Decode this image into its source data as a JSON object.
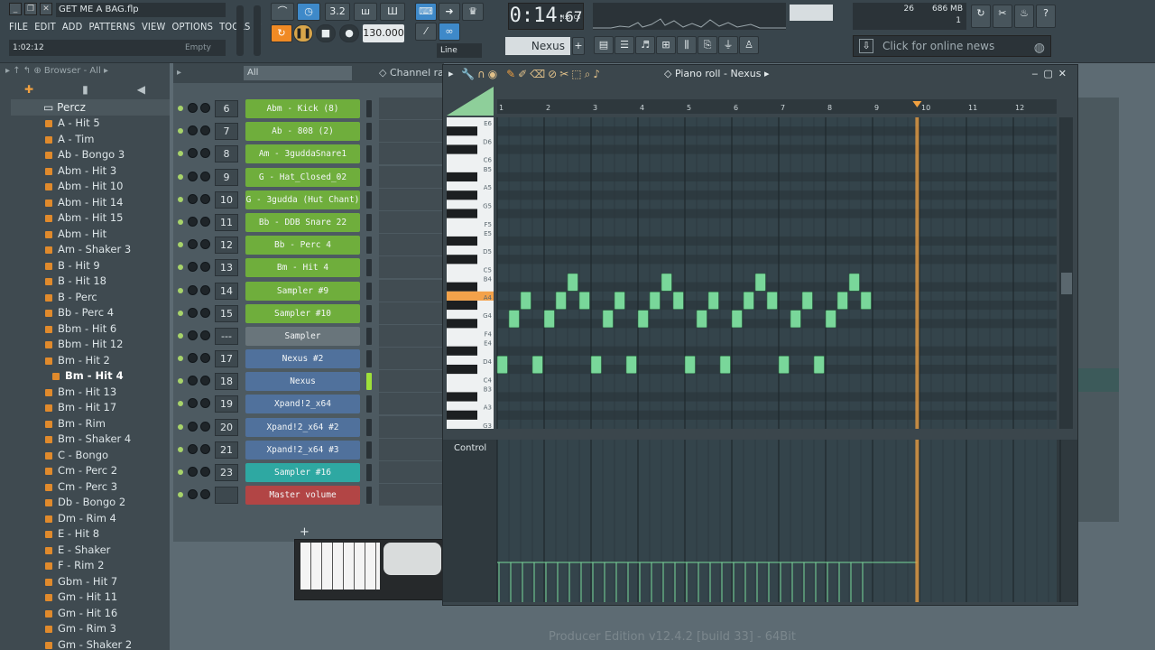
{
  "window": {
    "project_title": "GET ME A BAG.flp",
    "hint_time": "1:02:12",
    "hint_value": "Empty",
    "footer": "Producer Edition v12.4.2 [build 33] - 64Bit"
  },
  "menu": [
    "FILE",
    "EDIT",
    "ADD",
    "PATTERNS",
    "VIEW",
    "OPTIONS",
    "TOOLS",
    "?"
  ],
  "transport": {
    "time_main": "0:14",
    "time_sub": "67",
    "time_unit": "M:S:CS",
    "tempo": "130.000",
    "pattern_step": "3.2",
    "snap": "Line",
    "instrument": "Nexus"
  },
  "cpu": {
    "value": "26",
    "memory": "686 MB",
    "poly": "1"
  },
  "news": {
    "text": "Click for online news"
  },
  "browser": {
    "header": "Browser - All",
    "folder": "Percz",
    "active_item": "Bm - Hit 4",
    "items": [
      "A - Hit 5",
      "A - Tim",
      "Ab - Bongo 3",
      "Abm - Hit 3",
      "Abm - Hit 10",
      "Abm - Hit 14",
      "Abm - Hit 15",
      "Abm - Hit",
      "Am - Shaker 3",
      "B - Hit 9",
      "B - Hit 18",
      "B - Perc",
      "Bb - Perc 4",
      "Bbm - Hit 6",
      "Bbm - Hit 12",
      "Bm - Hit 2",
      "Bm - Hit 4",
      "Bm - Hit 13",
      "Bm - Hit 17",
      "Bm - Rim",
      "Bm - Shaker 4",
      "C - Bongo",
      "Cm - Perc 2",
      "Cm - Perc 3",
      "Db - Bongo 2",
      "Dm - Rim 4",
      "E - Hit 8",
      "E - Shaker",
      "F - Rim 2",
      "Gbm - Hit 7",
      "Gm - Hit 11",
      "Gm - Hit 16",
      "Gm - Rim 3",
      "Gm - Shaker 2"
    ]
  },
  "rack": {
    "filter": "All",
    "title": "Channel ra",
    "channels": [
      {
        "num": "6",
        "name": "Abm - Kick (8)",
        "color": "green",
        "meter": false
      },
      {
        "num": "7",
        "name": "Ab - 808 (2)",
        "color": "green",
        "meter": false
      },
      {
        "num": "8",
        "name": "Am - 3guddaSnare1",
        "color": "green",
        "meter": false
      },
      {
        "num": "9",
        "name": "G - Hat_Closed_02",
        "color": "green",
        "meter": false
      },
      {
        "num": "10",
        "name": "G - 3gudda (Hut Chant)",
        "color": "green",
        "meter": false
      },
      {
        "num": "11",
        "name": "Bb - DDB Snare 22",
        "color": "green",
        "meter": false
      },
      {
        "num": "12",
        "name": "Bb - Perc 4",
        "color": "green",
        "meter": false
      },
      {
        "num": "13",
        "name": "Bm - Hit 4",
        "color": "green",
        "meter": false
      },
      {
        "num": "14",
        "name": "Sampler #9",
        "color": "green",
        "meter": false
      },
      {
        "num": "15",
        "name": "Sampler #10",
        "color": "green",
        "meter": false
      },
      {
        "num": "---",
        "name": "Sampler",
        "color": "grey",
        "meter": false
      },
      {
        "num": "17",
        "name": "Nexus #2",
        "color": "blue",
        "meter": false
      },
      {
        "num": "18",
        "name": "Nexus",
        "color": "blue",
        "meter": true
      },
      {
        "num": "19",
        "name": "Xpand!2_x64",
        "color": "blue",
        "meter": false
      },
      {
        "num": "20",
        "name": "Xpand!2_x64 #2",
        "color": "blue",
        "meter": false
      },
      {
        "num": "21",
        "name": "Xpand!2_x64 #3",
        "color": "blue",
        "meter": false
      },
      {
        "num": "23",
        "name": "Sampler #16",
        "color": "teal",
        "meter": false
      },
      {
        "num": "",
        "name": "Master volume",
        "color": "red",
        "meter": false
      }
    ],
    "add_label": "+"
  },
  "piano_roll": {
    "title": "Piano roll - Nexus",
    "control_label": "Control",
    "control_target": "Velocity",
    "bar_labels": [
      "1",
      "2",
      "3",
      "4",
      "5",
      "6",
      "7",
      "8",
      "9",
      "10",
      "11",
      "12"
    ],
    "key_labels": [
      "E6",
      "D6",
      "C6",
      "B5",
      "A5",
      "G5",
      "F5",
      "E5",
      "D5",
      "C5",
      "B4",
      "A4",
      "G4",
      "F4",
      "E4",
      "D4",
      "C4",
      "B3",
      "A3",
      "G3"
    ],
    "highlighted_key": "A4",
    "playhead_bar": 8.95,
    "notes": [
      {
        "start": 0.0,
        "length": 0.22,
        "pitch": "D4"
      },
      {
        "start": 0.25,
        "length": 0.22,
        "pitch": "G4"
      },
      {
        "start": 0.5,
        "length": 0.22,
        "pitch": "A4"
      },
      {
        "start": 0.75,
        "length": 0.22,
        "pitch": "D4"
      },
      {
        "start": 1.0,
        "length": 0.22,
        "pitch": "G4"
      },
      {
        "start": 1.25,
        "length": 0.22,
        "pitch": "A4"
      },
      {
        "start": 1.5,
        "length": 0.22,
        "pitch": "B4"
      },
      {
        "start": 1.75,
        "length": 0.22,
        "pitch": "A4"
      },
      {
        "start": 2.0,
        "length": 0.22,
        "pitch": "D4"
      },
      {
        "start": 2.25,
        "length": 0.22,
        "pitch": "G4"
      },
      {
        "start": 2.5,
        "length": 0.22,
        "pitch": "A4"
      },
      {
        "start": 2.75,
        "length": 0.22,
        "pitch": "D4"
      },
      {
        "start": 3.0,
        "length": 0.22,
        "pitch": "G4"
      },
      {
        "start": 3.25,
        "length": 0.22,
        "pitch": "A4"
      },
      {
        "start": 3.5,
        "length": 0.22,
        "pitch": "B4"
      },
      {
        "start": 3.75,
        "length": 0.22,
        "pitch": "A4"
      },
      {
        "start": 4.0,
        "length": 0.22,
        "pitch": "D4"
      },
      {
        "start": 4.25,
        "length": 0.22,
        "pitch": "G4"
      },
      {
        "start": 4.5,
        "length": 0.22,
        "pitch": "A4"
      },
      {
        "start": 4.75,
        "length": 0.22,
        "pitch": "D4"
      },
      {
        "start": 5.0,
        "length": 0.22,
        "pitch": "G4"
      },
      {
        "start": 5.25,
        "length": 0.22,
        "pitch": "A4"
      },
      {
        "start": 5.5,
        "length": 0.22,
        "pitch": "B4"
      },
      {
        "start": 5.75,
        "length": 0.22,
        "pitch": "A4"
      },
      {
        "start": 6.0,
        "length": 0.22,
        "pitch": "D4"
      },
      {
        "start": 6.25,
        "length": 0.22,
        "pitch": "G4"
      },
      {
        "start": 6.5,
        "length": 0.22,
        "pitch": "A4"
      },
      {
        "start": 6.75,
        "length": 0.22,
        "pitch": "D4"
      },
      {
        "start": 7.0,
        "length": 0.22,
        "pitch": "G4"
      },
      {
        "start": 7.25,
        "length": 0.22,
        "pitch": "A4"
      },
      {
        "start": 7.5,
        "length": 0.22,
        "pitch": "B4"
      },
      {
        "start": 7.75,
        "length": 0.22,
        "pitch": "A4"
      }
    ]
  },
  "colors": {
    "note": "#79d79a",
    "playhead": "#f0a040",
    "highlight_key": "#f4a24a",
    "grid_bg": "#34444b"
  }
}
